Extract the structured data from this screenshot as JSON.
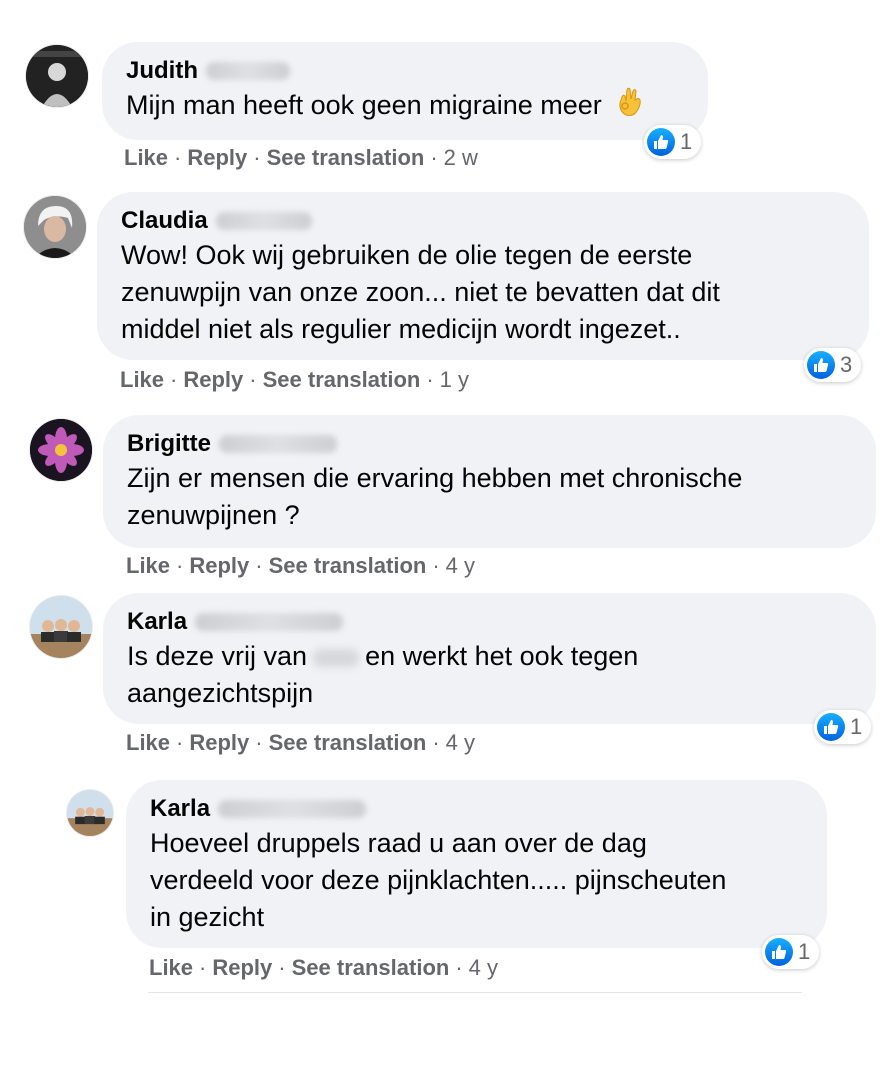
{
  "actions": {
    "like": "Like",
    "reply": "Reply",
    "translate": "See translation"
  },
  "comments": [
    {
      "author": "Judith",
      "lines": [
        "Mijn man heeft ook geen migraine meer"
      ],
      "emoji": "ok-hand-emoji",
      "reactions": "1",
      "time": "2 w"
    },
    {
      "author": "Claudia",
      "lines": [
        "Wow! Ook wij gebruiken de olie tegen de eerste",
        "zenuwpijn van onze zoon... niet te bevatten dat dit",
        "middel niet als regulier medicijn wordt ingezet.."
      ],
      "reactions": "3",
      "time": "1 y"
    },
    {
      "author": "Brigitte",
      "lines": [
        "Zijn er mensen die ervaring hebben met chronische",
        "zenuwpijnen ?"
      ],
      "time": "4 y"
    },
    {
      "author": "Karla",
      "line1_before": "Is deze vrij van",
      "line1_after": "en werkt het ook tegen",
      "line2": "aangezichtspijn",
      "reactions": "1",
      "time": "4 y"
    },
    {
      "author": "Karla",
      "lines": [
        "Hoeveel druppels raad u aan over de dag",
        "verdeeld voor deze pijnklachten..... pijnscheuten",
        "in gezicht"
      ],
      "reactions": "1",
      "time": "4 y"
    }
  ],
  "colors": {
    "bubble": "#f0f2f5",
    "meta": "#65676b",
    "like_blue": "#1877f2",
    "text": "#050505"
  }
}
